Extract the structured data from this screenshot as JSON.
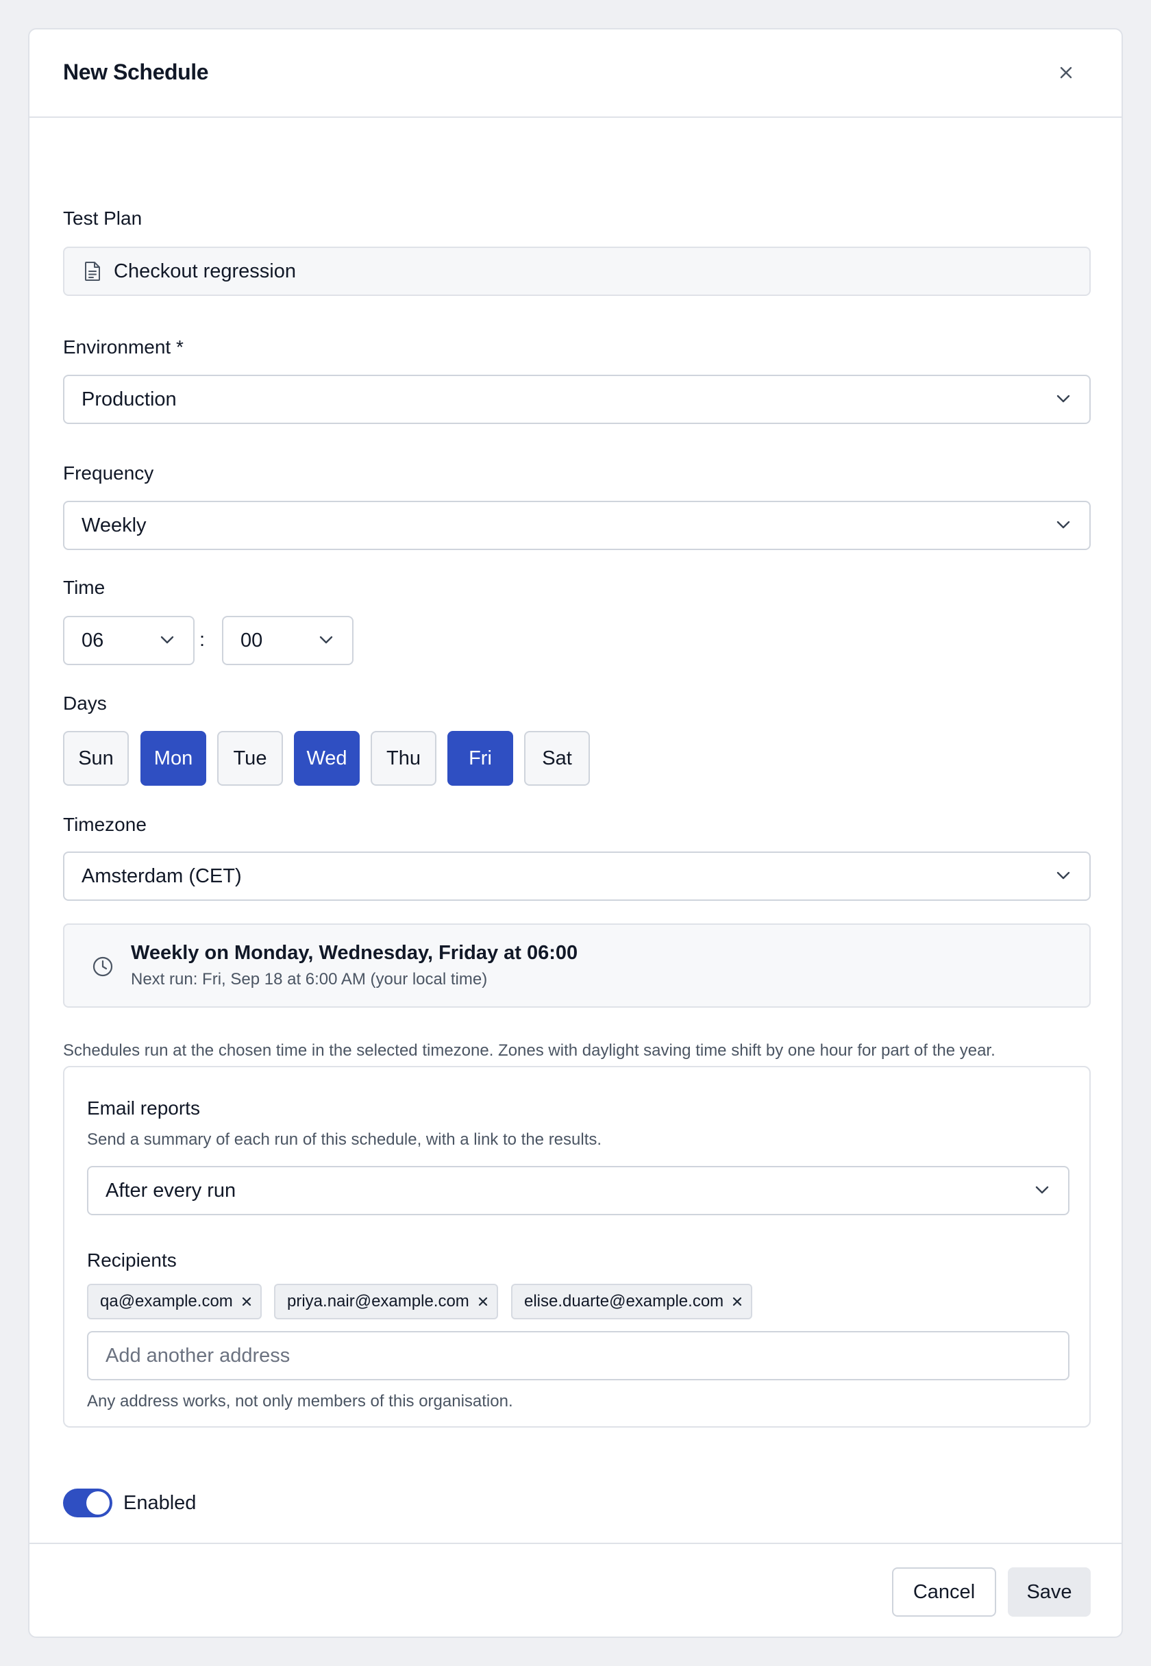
{
  "dialog": {
    "title": "New Schedule"
  },
  "test_plan": {
    "label": "Test Plan",
    "value": "Checkout regression"
  },
  "environment": {
    "label": "Environment *",
    "value": "Production"
  },
  "frequency": {
    "label": "Frequency",
    "value": "Weekly"
  },
  "time": {
    "label": "Time",
    "hour": "06",
    "separator": ":",
    "minute": "00"
  },
  "days": {
    "label": "Days",
    "items": [
      {
        "label": "Sun",
        "selected": false
      },
      {
        "label": "Mon",
        "selected": true
      },
      {
        "label": "Tue",
        "selected": false
      },
      {
        "label": "Wed",
        "selected": true
      },
      {
        "label": "Thu",
        "selected": false
      },
      {
        "label": "Fri",
        "selected": true
      },
      {
        "label": "Sat",
        "selected": false
      }
    ]
  },
  "timezone": {
    "label": "Timezone",
    "value": "Amsterdam (CET)"
  },
  "summary": {
    "main": "Weekly on Monday, Wednesday, Friday at 06:00",
    "sub": "Next run: Fri, Sep 18 at 6:00 AM (your local time)"
  },
  "timezone_hint": "Schedules run at the chosen time in the selected timezone. Zones with daylight saving time shift by one hour for part of the year.",
  "email_reports": {
    "title": "Email reports",
    "description": "Send a summary of each run of this schedule, with a link to the results.",
    "value": "After every run",
    "recipients_label": "Recipients",
    "recipients": [
      "qa@example.com",
      "priya.nair@example.com",
      "elise.duarte@example.com"
    ],
    "input_placeholder": "Add another address",
    "hint": "Any address works, not only members of this organisation."
  },
  "enabled": {
    "label": "Enabled",
    "on": true
  },
  "footer": {
    "cancel": "Cancel",
    "save": "Save"
  },
  "colors": {
    "accent": "#2f4fc2",
    "border": "#cfd4dc",
    "muted_text": "#4b5563"
  }
}
